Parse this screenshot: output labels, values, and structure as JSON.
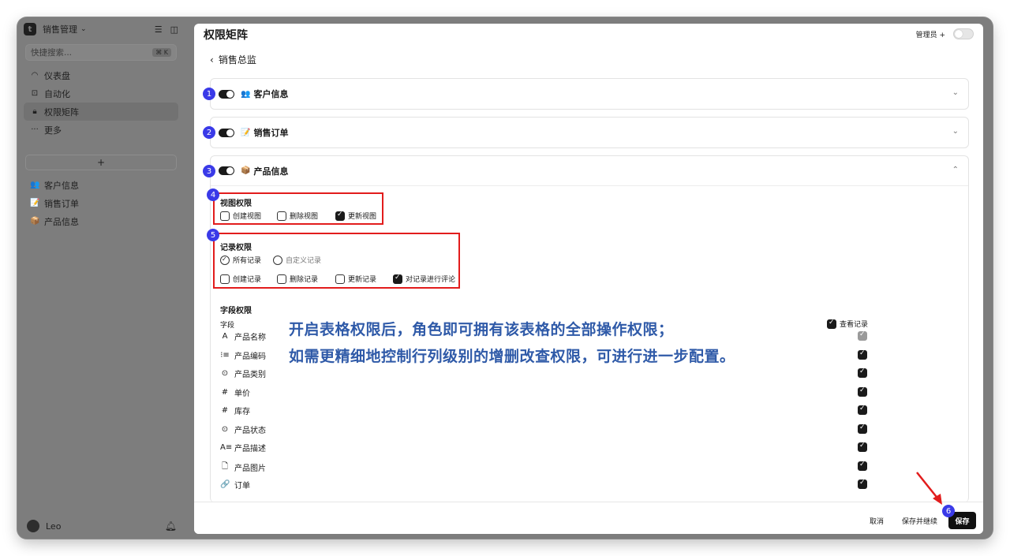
{
  "sidebar": {
    "workspace": "销售管理",
    "search_placeholder": "快捷搜索...",
    "search_shortcut": "⌘ K",
    "nav": [
      {
        "icon": "gauge-icon",
        "label": "仪表盘"
      },
      {
        "icon": "robot-icon",
        "label": "自动化"
      },
      {
        "icon": "lock-icon",
        "label": "权限矩阵"
      },
      {
        "icon": "more-icon",
        "label": "更多"
      }
    ],
    "add_label": "+",
    "tables": [
      {
        "icon": "👥",
        "label": "客户信息"
      },
      {
        "icon": "📝",
        "label": "销售订单"
      },
      {
        "icon": "📦",
        "label": "产品信息"
      }
    ],
    "user": "Leo"
  },
  "header": {
    "title": "权限矩阵",
    "role": "管理员",
    "role_add": "+"
  },
  "back_label": "销售总监",
  "sections": [
    {
      "num": "1",
      "emoji": "👥",
      "name": "客户信息",
      "chevron": "⌄"
    },
    {
      "num": "2",
      "emoji": "📝",
      "name": "销售订单",
      "chevron": "⌄"
    },
    {
      "num": "3",
      "emoji": "📦",
      "name": "产品信息",
      "chevron": "⌃"
    }
  ],
  "view_perm": {
    "num": "4",
    "title": "视图权限",
    "options": [
      {
        "label": "创建视图",
        "checked": false
      },
      {
        "label": "删除视图",
        "checked": false
      },
      {
        "label": "更新视图",
        "checked": true
      }
    ]
  },
  "record_perm": {
    "num": "5",
    "title": "记录权限",
    "scope": [
      {
        "label": "所有记录",
        "selected": true
      },
      {
        "label": "自定义记录",
        "selected": false
      }
    ],
    "options": [
      {
        "label": "创建记录",
        "checked": false
      },
      {
        "label": "删除记录",
        "checked": false
      },
      {
        "label": "更新记录",
        "checked": false
      },
      {
        "label": "对记录进行评论",
        "checked": true
      }
    ]
  },
  "field_perm": {
    "title": "字段权限",
    "col_field": "字段",
    "col_view": "查看记录",
    "fields": [
      {
        "icon": "A",
        "name": "产品名称",
        "state": "grey"
      },
      {
        "icon": "⁝≡",
        "name": "产品编码",
        "state": "on"
      },
      {
        "icon": "⊙",
        "name": "产品类别",
        "state": "on"
      },
      {
        "icon": "#",
        "name": "单价",
        "state": "on"
      },
      {
        "icon": "#",
        "name": "库存",
        "state": "on"
      },
      {
        "icon": "⊙",
        "name": "产品状态",
        "state": "on"
      },
      {
        "icon": "A≡",
        "name": "产品描述",
        "state": "on"
      },
      {
        "icon": "🗋",
        "name": "产品图片",
        "state": "on"
      },
      {
        "icon": "🔗",
        "name": "订单",
        "state": "on"
      }
    ]
  },
  "annotation": {
    "line1": "开启表格权限后，角色即可拥有该表格的全部操作权限；",
    "line2": "如需更精细地控制行列级别的增删改查权限，可进行进一步配置。"
  },
  "footer": {
    "cancel": "取消",
    "save_continue": "保存并继续",
    "save": "保存",
    "num": "6"
  },
  "colors": {
    "accent_badge": "#3a3ae8",
    "highlight_box": "#e21c1c",
    "annotation_text": "#2f5aa8",
    "arrow": "#e21c1c"
  }
}
